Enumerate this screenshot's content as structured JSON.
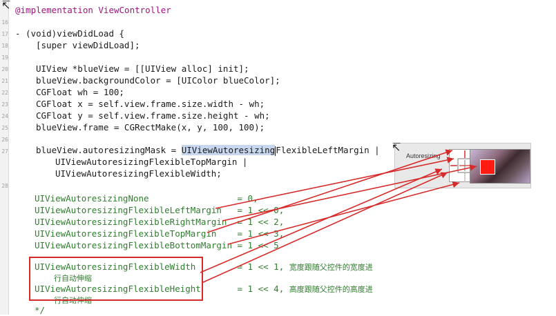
{
  "line_numbers": [
    {
      "n": "16"
    },
    {
      "n": "17"
    },
    {
      "n": "18"
    },
    {
      "n": "19"
    },
    {
      "n": "20"
    },
    {
      "n": "21"
    },
    {
      "n": "22"
    },
    {
      "n": "23"
    },
    {
      "n": "24"
    },
    {
      "n": "25"
    },
    {
      "n": "26"
    },
    {
      "n": "27"
    },
    {
      "n": "28"
    }
  ],
  "code": {
    "implementation": "@implementation ViewController",
    "method_sig": "- (void)viewDidLoad {",
    "super_call": "[super viewDidLoad];",
    "l20": "UIView *blueView = [[UIView alloc] init];",
    "l21": "blueView.backgroundColor = [UIColor blueColor];",
    "l22": "CGFloat wh = 100;",
    "l23": "CGFloat x = self.view.frame.size.width - wh;",
    "l24": "CGFloat y = self.view.frame.size.height - wh;",
    "l25": "blueView.frame = CGRectMake(x, y, 100, 100);",
    "l27_a": "blueView.autoresizingMask = ",
    "l27_sel": "UIViewAutoresizing",
    "l27_c": "FlexibleLeftMargin |",
    "l27_2": "UIViewAutoresizingFlexibleTopMargin |",
    "l27_3": "UIViewAutoresizingFlexibleWidth;",
    "enum_none": "UIViewAutoresizingNone                 = 0,",
    "enum_left": "UIViewAutoresizingFlexibleLeftMargin   = 1 << 0,",
    "enum_right": "UIViewAutoresizingFlexibleRightMargin  = 1 << 2,",
    "enum_top": "UIViewAutoresizingFlexibleTopMargin    = 1 << 3,",
    "enum_bottom": "UIViewAutoresizingFlexibleBottomMargin = 1 << 5",
    "enum_width": "UIViewAutoresizingFlexibleWidth        = 1 << 1, ",
    "enum_width_cn": "宽度跟随父控件的宽度进",
    "enum_width_cn2": "行自动伸缩",
    "enum_height": "UIViewAutoresizingFlexibleHeight       = 1 << 4, ",
    "enum_height_cn": "高度跟随父控件的高度进",
    "enum_height_cn2": "行自动伸缩",
    "comment_end": "*/"
  },
  "inspector": {
    "label": "Autoresizing"
  },
  "colors": {
    "arrow": "#d62a2a",
    "highlight": "#d62a2a",
    "preview_square": "#ff1a12"
  }
}
